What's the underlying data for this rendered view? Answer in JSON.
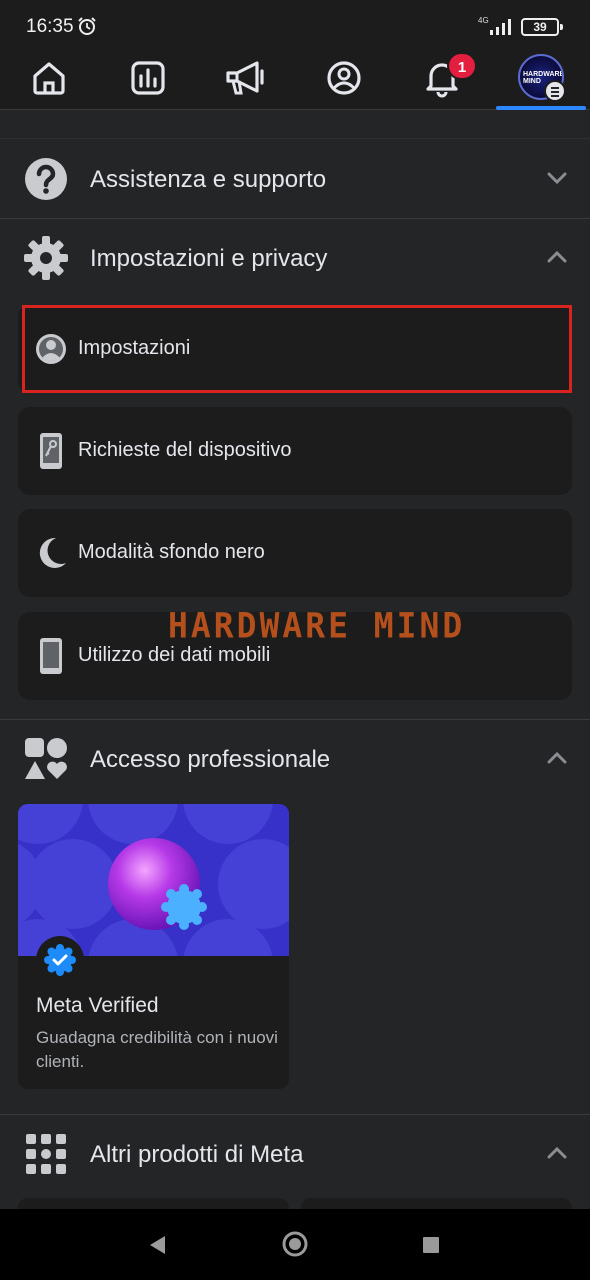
{
  "status_bar": {
    "time": "16:35",
    "network": "4G",
    "battery": "39"
  },
  "top_nav": {
    "notifications_badge": "1",
    "active_tab": "menu",
    "avatar_text": "HARDWARE MIND"
  },
  "sections": {
    "help": {
      "title": "Assistenza e supporto",
      "expanded": false
    },
    "settings": {
      "title": "Impostazioni e privacy",
      "expanded": true,
      "items": [
        {
          "label": "Impostazioni",
          "icon": "profile-circle-icon",
          "highlighted": true
        },
        {
          "label": "Richieste del dispositivo",
          "icon": "phone-key-icon"
        },
        {
          "label": "Modalità sfondo nero",
          "icon": "moon-icon"
        },
        {
          "label": "Utilizzo dei dati mobili",
          "icon": "mobile-phone-icon"
        }
      ]
    },
    "professional": {
      "title": "Accesso professionale",
      "expanded": true,
      "card": {
        "title": "Meta Verified",
        "description": "Guadagna credibilità con i nuovi clienti."
      }
    },
    "more_products": {
      "title": "Altri prodotti di Meta",
      "expanded": true
    }
  },
  "watermark": "HARDWARE MIND",
  "colors": {
    "background": "#242526",
    "card": "#1c1c1d",
    "accent_blue": "#2d88ff",
    "highlight_red": "#d9231f",
    "badge_red": "#e41e3f",
    "banner_purple": "#3730c9"
  }
}
